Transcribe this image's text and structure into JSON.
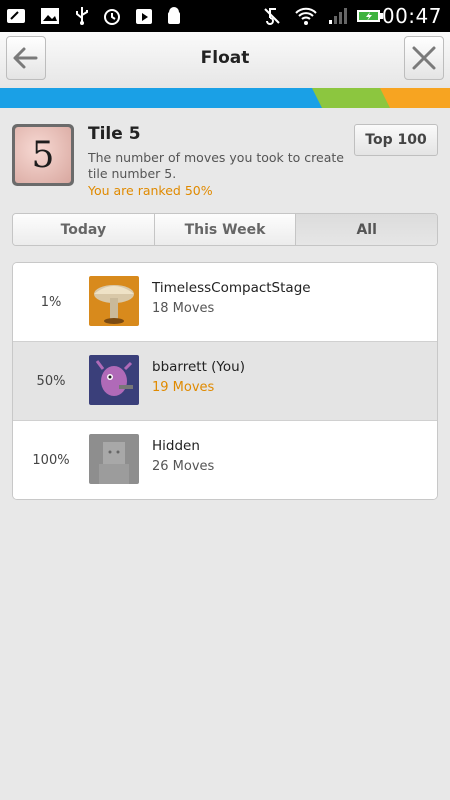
{
  "status_bar": {
    "time": "00:47",
    "icons": [
      "nfc-icon",
      "image-icon",
      "usb-icon",
      "alarm-icon",
      "play-store-icon",
      "android-debug-icon",
      "mute-icon",
      "wifi-icon",
      "signal-icon",
      "battery-charging-icon"
    ]
  },
  "action_bar": {
    "title": "Float",
    "back_icon": "arrow-left-icon",
    "close_icon": "close-icon"
  },
  "header": {
    "tile_number": "5",
    "title": "Tile 5",
    "description": "The number of moves you took to create tile number 5.",
    "rank_text": "You are ranked 50%",
    "top_button": "Top 100"
  },
  "tabs": [
    {
      "label": "Today",
      "active": false
    },
    {
      "label": "This Week",
      "active": false
    },
    {
      "label": "All",
      "active": true
    }
  ],
  "leaderboard": [
    {
      "rank": "1%",
      "name": "TimelessCompactStage",
      "moves": "18 Moves",
      "avatar": "mushroom-avatar"
    },
    {
      "rank": "50%",
      "name": "bbarrett (You)",
      "moves": "19 Moves",
      "avatar": "creature-avatar",
      "is_user": true
    },
    {
      "rank": "100%",
      "name": "Hidden",
      "moves": "26 Moves",
      "avatar": "default-avatar"
    }
  ],
  "colors": {
    "accent_orange": "#e08a00",
    "stripe_blue": "#1aa0e6",
    "stripe_green": "#8cc63f",
    "stripe_orange": "#f7a421"
  }
}
